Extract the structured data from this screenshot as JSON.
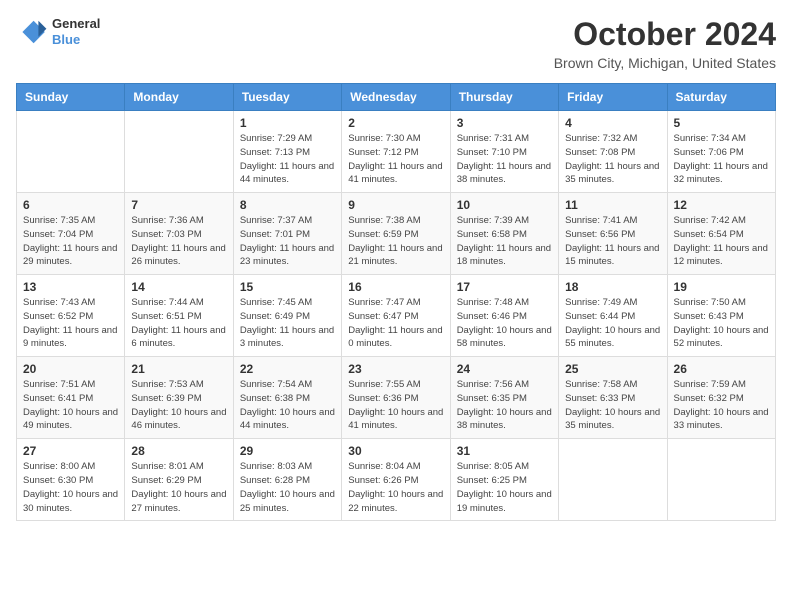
{
  "header": {
    "logo_line1": "General",
    "logo_line2": "Blue",
    "title": "October 2024",
    "location": "Brown City, Michigan, United States"
  },
  "weekdays": [
    "Sunday",
    "Monday",
    "Tuesday",
    "Wednesday",
    "Thursday",
    "Friday",
    "Saturday"
  ],
  "weeks": [
    [
      {
        "day": "",
        "info": ""
      },
      {
        "day": "",
        "info": ""
      },
      {
        "day": "1",
        "info": "Sunrise: 7:29 AM\nSunset: 7:13 PM\nDaylight: 11 hours and 44 minutes."
      },
      {
        "day": "2",
        "info": "Sunrise: 7:30 AM\nSunset: 7:12 PM\nDaylight: 11 hours and 41 minutes."
      },
      {
        "day": "3",
        "info": "Sunrise: 7:31 AM\nSunset: 7:10 PM\nDaylight: 11 hours and 38 minutes."
      },
      {
        "day": "4",
        "info": "Sunrise: 7:32 AM\nSunset: 7:08 PM\nDaylight: 11 hours and 35 minutes."
      },
      {
        "day": "5",
        "info": "Sunrise: 7:34 AM\nSunset: 7:06 PM\nDaylight: 11 hours and 32 minutes."
      }
    ],
    [
      {
        "day": "6",
        "info": "Sunrise: 7:35 AM\nSunset: 7:04 PM\nDaylight: 11 hours and 29 minutes."
      },
      {
        "day": "7",
        "info": "Sunrise: 7:36 AM\nSunset: 7:03 PM\nDaylight: 11 hours and 26 minutes."
      },
      {
        "day": "8",
        "info": "Sunrise: 7:37 AM\nSunset: 7:01 PM\nDaylight: 11 hours and 23 minutes."
      },
      {
        "day": "9",
        "info": "Sunrise: 7:38 AM\nSunset: 6:59 PM\nDaylight: 11 hours and 21 minutes."
      },
      {
        "day": "10",
        "info": "Sunrise: 7:39 AM\nSunset: 6:58 PM\nDaylight: 11 hours and 18 minutes."
      },
      {
        "day": "11",
        "info": "Sunrise: 7:41 AM\nSunset: 6:56 PM\nDaylight: 11 hours and 15 minutes."
      },
      {
        "day": "12",
        "info": "Sunrise: 7:42 AM\nSunset: 6:54 PM\nDaylight: 11 hours and 12 minutes."
      }
    ],
    [
      {
        "day": "13",
        "info": "Sunrise: 7:43 AM\nSunset: 6:52 PM\nDaylight: 11 hours and 9 minutes."
      },
      {
        "day": "14",
        "info": "Sunrise: 7:44 AM\nSunset: 6:51 PM\nDaylight: 11 hours and 6 minutes."
      },
      {
        "day": "15",
        "info": "Sunrise: 7:45 AM\nSunset: 6:49 PM\nDaylight: 11 hours and 3 minutes."
      },
      {
        "day": "16",
        "info": "Sunrise: 7:47 AM\nSunset: 6:47 PM\nDaylight: 11 hours and 0 minutes."
      },
      {
        "day": "17",
        "info": "Sunrise: 7:48 AM\nSunset: 6:46 PM\nDaylight: 10 hours and 58 minutes."
      },
      {
        "day": "18",
        "info": "Sunrise: 7:49 AM\nSunset: 6:44 PM\nDaylight: 10 hours and 55 minutes."
      },
      {
        "day": "19",
        "info": "Sunrise: 7:50 AM\nSunset: 6:43 PM\nDaylight: 10 hours and 52 minutes."
      }
    ],
    [
      {
        "day": "20",
        "info": "Sunrise: 7:51 AM\nSunset: 6:41 PM\nDaylight: 10 hours and 49 minutes."
      },
      {
        "day": "21",
        "info": "Sunrise: 7:53 AM\nSunset: 6:39 PM\nDaylight: 10 hours and 46 minutes."
      },
      {
        "day": "22",
        "info": "Sunrise: 7:54 AM\nSunset: 6:38 PM\nDaylight: 10 hours and 44 minutes."
      },
      {
        "day": "23",
        "info": "Sunrise: 7:55 AM\nSunset: 6:36 PM\nDaylight: 10 hours and 41 minutes."
      },
      {
        "day": "24",
        "info": "Sunrise: 7:56 AM\nSunset: 6:35 PM\nDaylight: 10 hours and 38 minutes."
      },
      {
        "day": "25",
        "info": "Sunrise: 7:58 AM\nSunset: 6:33 PM\nDaylight: 10 hours and 35 minutes."
      },
      {
        "day": "26",
        "info": "Sunrise: 7:59 AM\nSunset: 6:32 PM\nDaylight: 10 hours and 33 minutes."
      }
    ],
    [
      {
        "day": "27",
        "info": "Sunrise: 8:00 AM\nSunset: 6:30 PM\nDaylight: 10 hours and 30 minutes."
      },
      {
        "day": "28",
        "info": "Sunrise: 8:01 AM\nSunset: 6:29 PM\nDaylight: 10 hours and 27 minutes."
      },
      {
        "day": "29",
        "info": "Sunrise: 8:03 AM\nSunset: 6:28 PM\nDaylight: 10 hours and 25 minutes."
      },
      {
        "day": "30",
        "info": "Sunrise: 8:04 AM\nSunset: 6:26 PM\nDaylight: 10 hours and 22 minutes."
      },
      {
        "day": "31",
        "info": "Sunrise: 8:05 AM\nSunset: 6:25 PM\nDaylight: 10 hours and 19 minutes."
      },
      {
        "day": "",
        "info": ""
      },
      {
        "day": "",
        "info": ""
      }
    ]
  ]
}
